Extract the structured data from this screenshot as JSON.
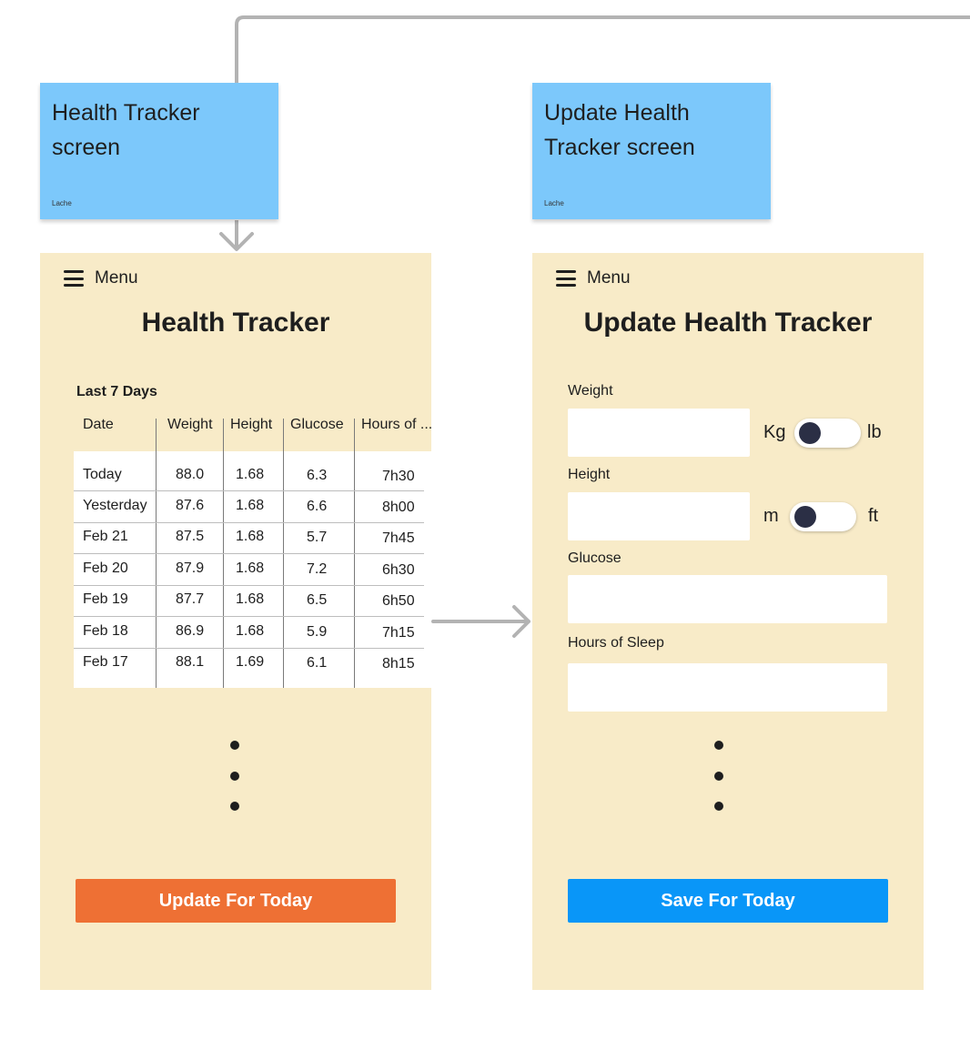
{
  "stickies": {
    "left": {
      "title": "Health Tracker screen",
      "author": "Lache"
    },
    "right": {
      "title": "Update Health Tracker screen",
      "author": "Lache"
    }
  },
  "health_tracker": {
    "menu_label": "Menu",
    "title": "Health Tracker",
    "table_caption": "Last 7 Days",
    "columns": [
      "Date",
      "Weight",
      "Height",
      "Glucose",
      "Hours of ..."
    ],
    "rows": [
      [
        "Today",
        "88.0",
        "1.68",
        "6.3",
        "7h30"
      ],
      [
        "Yesterday",
        "87.6",
        "1.68",
        "6.6",
        "8h00"
      ],
      [
        "Feb 21",
        "87.5",
        "1.68",
        "5.7",
        "7h45"
      ],
      [
        "Feb 20",
        "87.9",
        "1.68",
        "7.2",
        "6h30"
      ],
      [
        "Feb 19",
        "87.7",
        "1.68",
        "6.5",
        "6h50"
      ],
      [
        "Feb 18",
        "86.9",
        "1.68",
        "5.9",
        "7h15"
      ],
      [
        "Feb 17",
        "88.1",
        "1.69",
        "6.1",
        "8h15"
      ]
    ],
    "button_label": "Update For Today",
    "button_color": "#ee7034"
  },
  "update_tracker": {
    "menu_label": "Menu",
    "title": "Update Health Tracker",
    "weight": {
      "label": "Weight",
      "value": "",
      "unit_left": "Kg",
      "unit_right": "lb"
    },
    "height": {
      "label": "Height",
      "value": "",
      "unit_left": "m",
      "unit_right": "ft"
    },
    "glucose": {
      "label": "Glucose",
      "value": ""
    },
    "sleep": {
      "label": "Hours of Sleep",
      "value": ""
    },
    "button_label": "Save For Today",
    "button_color": "#0996f8"
  },
  "colors": {
    "sticky": "#7cc8fb",
    "screen_bg": "#f8ebc8",
    "connector": "#b3b3b3"
  },
  "icons": [
    "hamburger-menu-icon",
    "arrow-down-connector",
    "arrow-right-connector",
    "ellipsis-dots"
  ]
}
